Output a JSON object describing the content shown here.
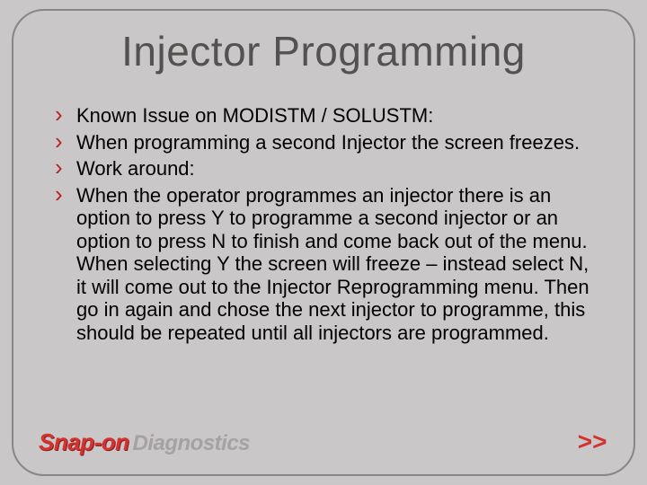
{
  "title": "Injector Programming",
  "bullets": [
    "Known Issue on MODISTM / SOLUSTM:",
    "When programming a second Injector the screen freezes.",
    "Work around:",
    "When the operator programmes an injector there is an option to press Y to programme a second injector or an option to press N to finish and come back out of the menu. When selecting Y the screen will freeze – instead select N, it will come out to the Injector Reprogramming menu. Then go in again and chose the next injector to programme, this should be repeated until all injectors are programmed."
  ],
  "logo": {
    "brand": "Snap-on",
    "product": "Diagnostics"
  },
  "nav": {
    "next": ">>"
  }
}
